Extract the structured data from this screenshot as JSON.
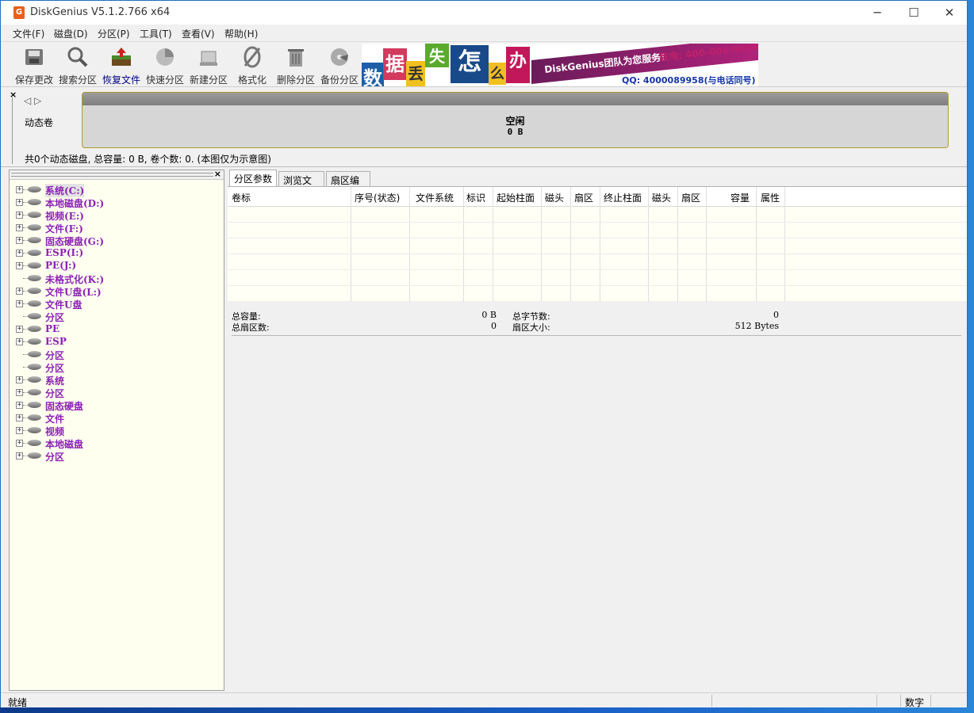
{
  "window": {
    "title": "DiskGenius V5.1.2.766 x64",
    "app_icon": "G",
    "buttons": {
      "minimize": "─",
      "maximize": "☐",
      "close": "✕"
    }
  },
  "menu": [
    "文件(F)",
    "磁盘(D)",
    "分区(P)",
    "工具(T)",
    "查看(V)",
    "帮助(H)"
  ],
  "toolbar": {
    "buttons": [
      {
        "label": "保存更改",
        "icon": "save-disk-icon"
      },
      {
        "label": "搜索分区",
        "icon": "magnifier-icon"
      },
      {
        "label": "恢复文件",
        "icon": "recover-files-icon",
        "active": true
      },
      {
        "label": "快速分区",
        "icon": "quick-partition-icon"
      },
      {
        "label": "新建分区",
        "icon": "new-partition-icon"
      },
      {
        "label": "格式化",
        "icon": "format-icon"
      },
      {
        "label": "删除分区",
        "icon": "trash-icon"
      },
      {
        "label": "备份分区",
        "icon": "backup-disc-icon"
      }
    ],
    "banner": {
      "tiles": [
        "数",
        "据",
        "丢",
        "失",
        "怎",
        "么",
        "办"
      ],
      "promo": "DiskGenius团队为您服务!",
      "phone": "致电: 400-008-9958",
      "qq": "QQ: 4000089958(与电话同号)"
    }
  },
  "diskmap": {
    "close": "×",
    "arrows": "◁ ▷",
    "label": "动态卷",
    "volume_name": "空闲",
    "volume_size": "0 B",
    "summary": "共0个动态磁盘, 总容量: 0 B, 卷个数: 0. (本图仅为示意图)"
  },
  "tree": {
    "close": "×",
    "items": [
      {
        "label": "系统(C:)",
        "expandable": true
      },
      {
        "label": "本地磁盘(D:)",
        "expandable": true
      },
      {
        "label": "视频(E:)",
        "expandable": true
      },
      {
        "label": "文件(F:)",
        "expandable": true
      },
      {
        "label": "固态硬盘(G:)",
        "expandable": true
      },
      {
        "label": "ESP(I:)",
        "expandable": true
      },
      {
        "label": "PE(J:)",
        "expandable": true
      },
      {
        "label": "未格式化(K:)",
        "expandable": false
      },
      {
        "label": "文件U盘(L:)",
        "expandable": true
      },
      {
        "label": "文件U盘",
        "expandable": true
      },
      {
        "label": "分区",
        "expandable": false
      },
      {
        "label": "PE",
        "expandable": true
      },
      {
        "label": "ESP",
        "expandable": true
      },
      {
        "label": "分区",
        "expandable": false
      },
      {
        "label": "分区",
        "expandable": false
      },
      {
        "label": "系统",
        "expandable": true
      },
      {
        "label": "分区",
        "expandable": true
      },
      {
        "label": "固态硬盘",
        "expandable": true
      },
      {
        "label": "文件",
        "expandable": true
      },
      {
        "label": "视频",
        "expandable": true
      },
      {
        "label": "本地磁盘",
        "expandable": true
      },
      {
        "label": "分区",
        "expandable": true
      }
    ]
  },
  "tabs": [
    "分区参数",
    "浏览文件",
    "扇区编辑"
  ],
  "grid": {
    "columns": [
      "卷标",
      "序号(状态)",
      "文件系统",
      "标识",
      "起始柱面",
      "磁头",
      "扇区",
      "终止柱面",
      "磁头",
      "扇区",
      "容量",
      "属性"
    ]
  },
  "stats": {
    "total_capacity_label": "总容量:",
    "total_capacity_value": "0 B",
    "total_sectors_label": "总扇区数:",
    "total_sectors_value": "0",
    "total_bytes_label": "总字节数:",
    "total_bytes_value": "0",
    "sector_size_label": "扇区大小:",
    "sector_size_value": "512 Bytes"
  },
  "status": {
    "text": "就绪",
    "numlock": "数字"
  }
}
